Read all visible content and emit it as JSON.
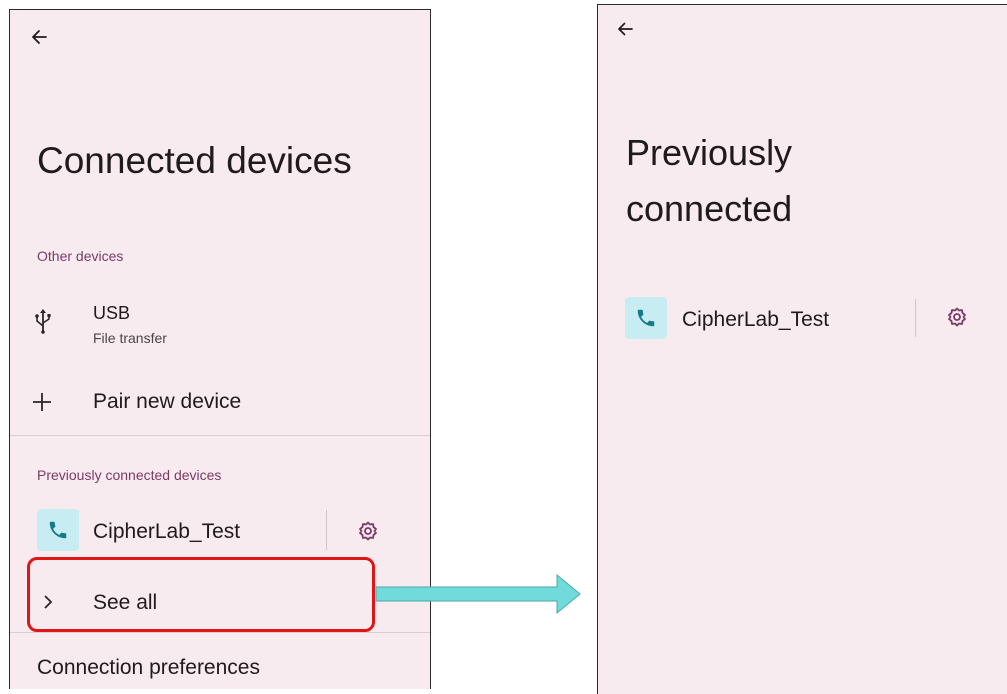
{
  "left": {
    "title": "Connected devices",
    "other_devices_header": "Other devices",
    "usb": {
      "title": "USB",
      "subtitle": "File transfer"
    },
    "pair_new_device": "Pair new device",
    "previously_connected_header": "Previously connected devices",
    "device_name": "CipherLab_Test",
    "see_all": "See all",
    "connection_preferences": "Connection preferences"
  },
  "right": {
    "title_line1": "Previously",
    "title_line2": "connected",
    "device_name": "CipherLab_Test"
  },
  "colors": {
    "screen_bg": "#f7ebef",
    "section_header": "#7b3a66",
    "device_badge": "#c7ecf1",
    "phone_icon": "#167a8a",
    "highlight_border": "#e01616",
    "arrow_fill": "#71dada"
  },
  "icons": [
    "back-arrow-icon",
    "usb-icon",
    "plus-icon",
    "phone-icon",
    "gear-icon",
    "chevron-right-icon"
  ]
}
